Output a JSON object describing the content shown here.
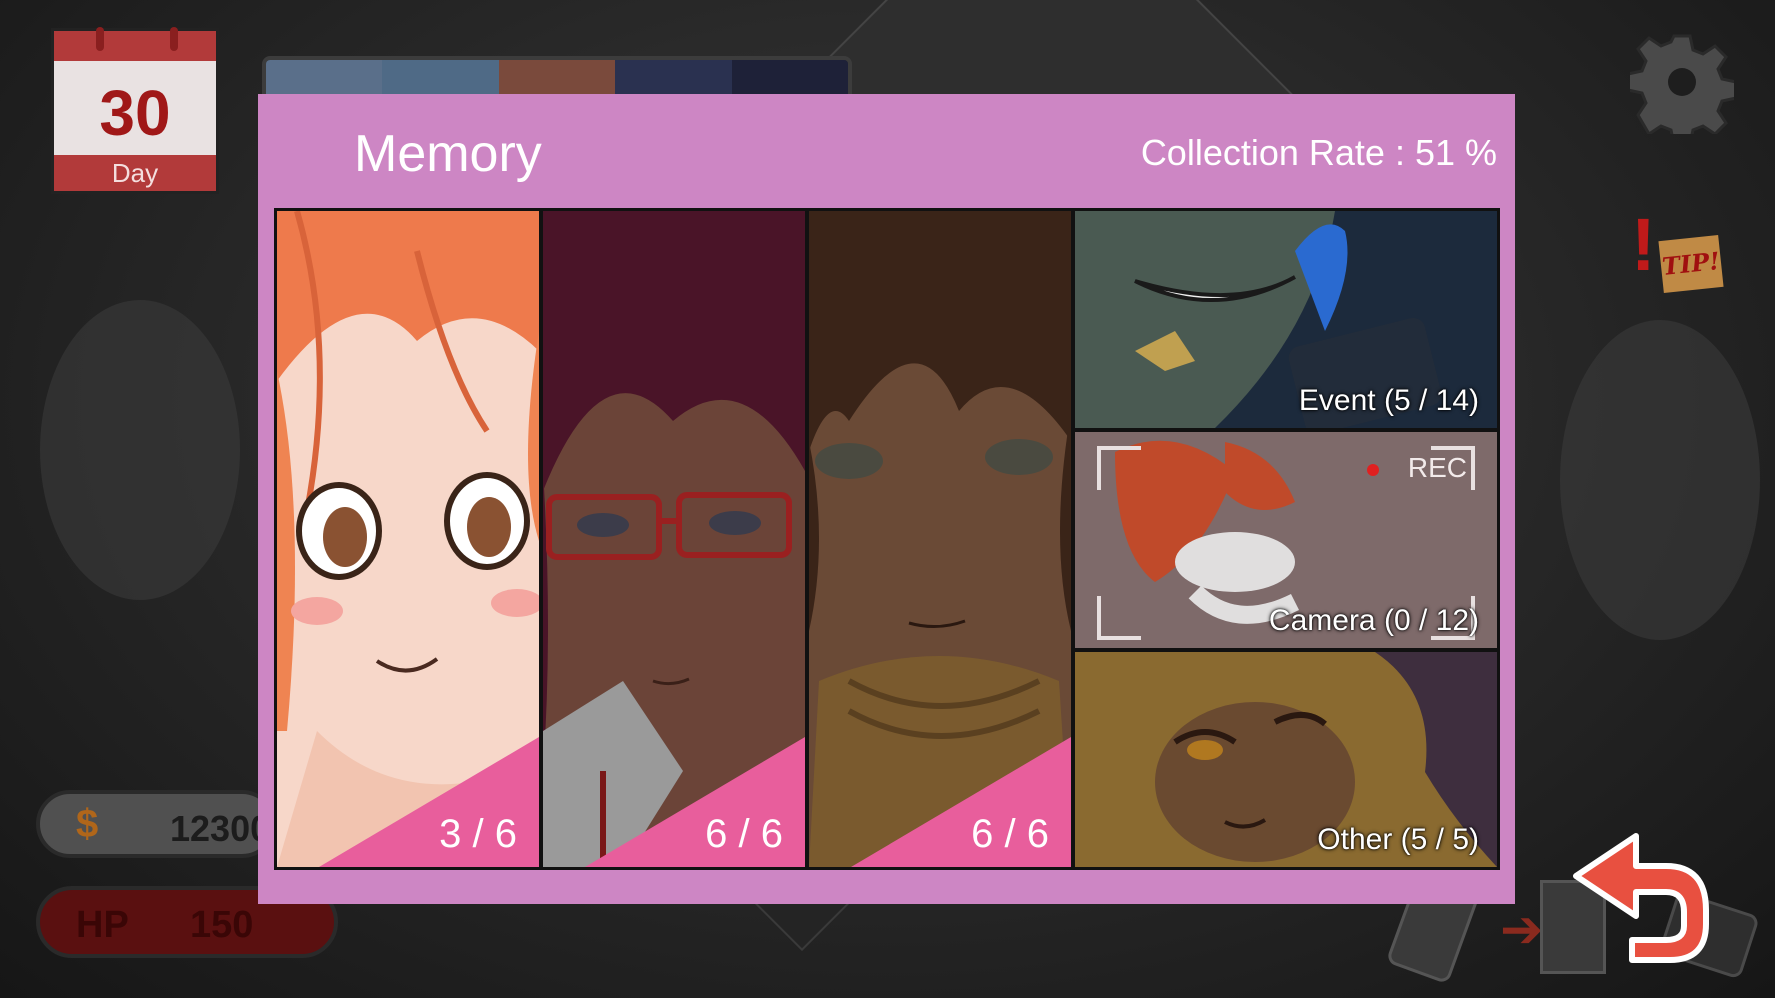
{
  "hud": {
    "calendar": {
      "day_number": "30",
      "day_label": "Day"
    },
    "money": {
      "icon": "money-icon",
      "symbol": "$",
      "value": "12300"
    },
    "hp": {
      "label": "HP",
      "value": "150"
    },
    "time_strip": {
      "segment_colors": [
        "#5a6f8a",
        "#4f6a86",
        "#7a4a3c",
        "#2a3150",
        "#1e2138"
      ]
    }
  },
  "memory": {
    "title": "Memory",
    "collection_rate": "Collection Rate : 51 %",
    "characters": [
      {
        "count": "3 / 6"
      },
      {
        "count": "6 / 6"
      },
      {
        "count": "6 / 6"
      }
    ],
    "categories": {
      "event": "Event (5 / 14)",
      "camera": "Camera (0 / 12)",
      "camera_rec": "REC",
      "other": "Other (5 / 5)"
    }
  },
  "tip": {
    "text": "TIP!"
  },
  "colors": {
    "panel": "#cd86c4",
    "badge": "#e85e9c",
    "back_arrow": "#e85040"
  }
}
